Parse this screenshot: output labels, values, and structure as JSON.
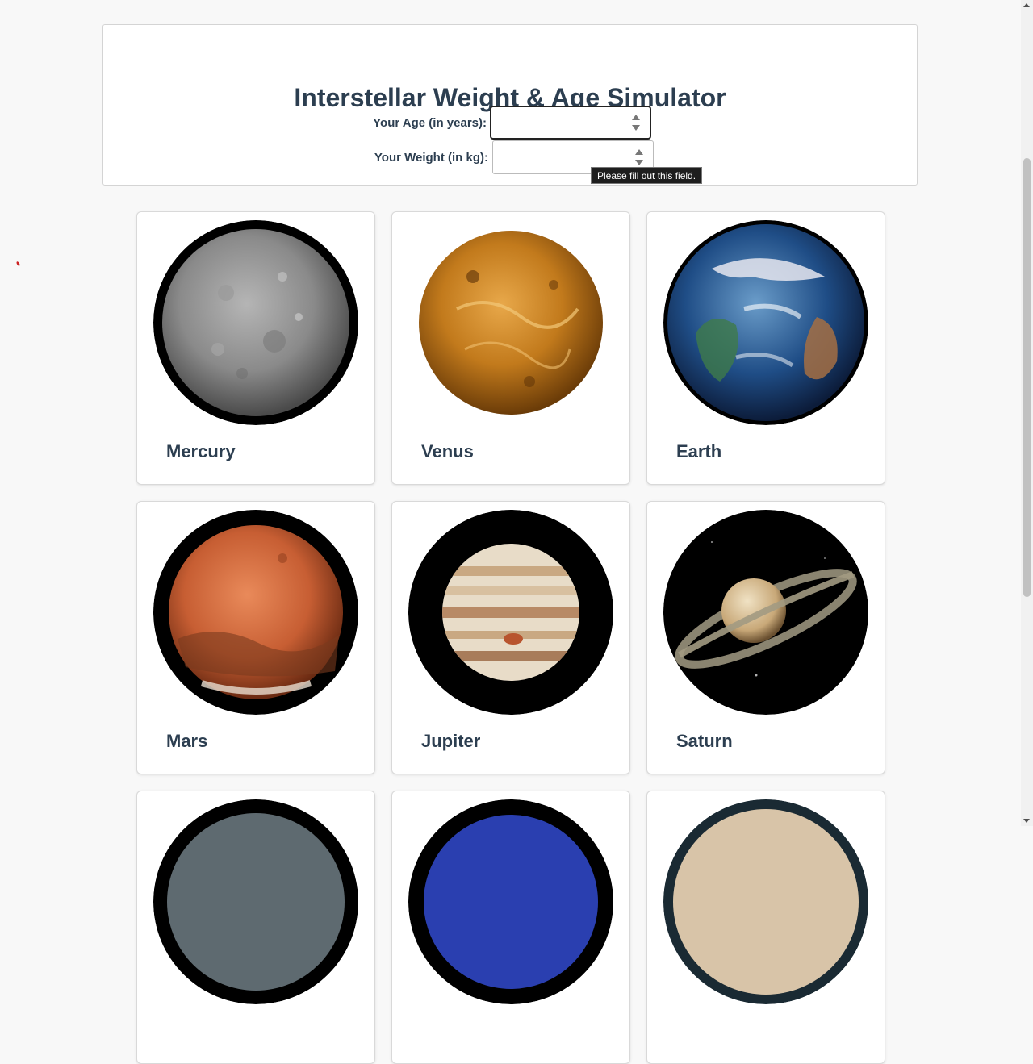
{
  "header": {
    "title": "Interstellar Weight & Age Simulator"
  },
  "form": {
    "age_label": "Your Age (in years):",
    "age_value": "",
    "weight_label": "Your Weight (in kg):",
    "weight_value": "",
    "validation_tooltip": "Please fill out this field."
  },
  "planets": [
    {
      "name": "Mercury",
      "image": "mercury-image"
    },
    {
      "name": "Venus",
      "image": "venus-image"
    },
    {
      "name": "Earth",
      "image": "earth-image"
    },
    {
      "name": "Mars",
      "image": "mars-image"
    },
    {
      "name": "Jupiter",
      "image": "jupiter-image"
    },
    {
      "name": "Saturn",
      "image": "saturn-image"
    },
    {
      "name": "",
      "image": "uranus-image"
    },
    {
      "name": "",
      "image": "neptune-image"
    },
    {
      "name": "",
      "image": "pluto-image"
    }
  ],
  "colors": {
    "page_background": "#f8f8f8",
    "heading_text": "#2c3e50",
    "card_background": "#ffffff",
    "tooltip_background": "#1e1e1e"
  }
}
